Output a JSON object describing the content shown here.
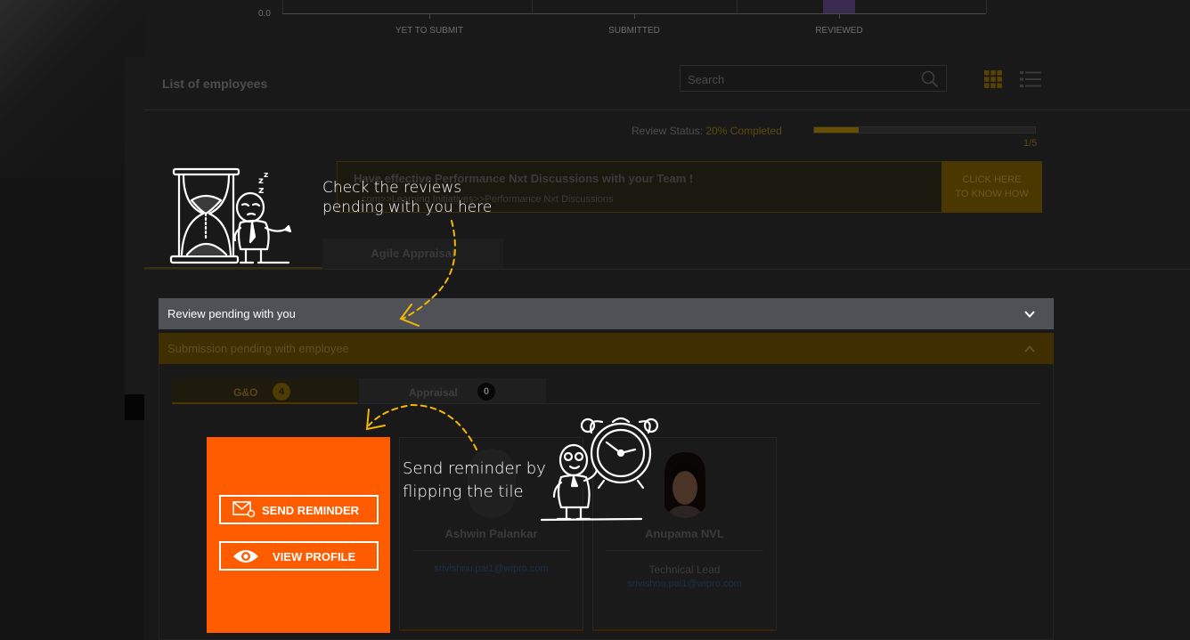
{
  "chart": {
    "y_tick": "0.0",
    "x_labels": [
      "YET TO SUBMIT",
      "SUBMITTED",
      "REVIEWED"
    ]
  },
  "list": {
    "title": "List of employees",
    "search_placeholder": "Search"
  },
  "review_status": {
    "label": "Review Status: ",
    "value": "20% Completed",
    "progress_fraction": 0.2,
    "count": "1/5"
  },
  "banner": {
    "title": "Have effective Performance Nxt Discussions with your Team !",
    "path": "...com>>Learning Initiatives>>Performance Nxt Discussions",
    "cta_line1": "CLICK HERE",
    "cta_line2": "TO KNOW HOW"
  },
  "tabs": {
    "agile": "Agile Appraisal"
  },
  "accordion": {
    "review_pending": "Review pending with you",
    "submission_pending": "Submission pending with employee"
  },
  "sub_tabs": [
    {
      "label": "G&O",
      "count": "4"
    },
    {
      "label": "Appraisal",
      "count": "0"
    }
  ],
  "flip_tile": {
    "send_reminder": "SEND REMINDER",
    "view_profile": "VIEW PROFILE"
  },
  "cards": [
    {
      "name": "Ashwin Palankar",
      "role": "",
      "email": "srivishnu.pai1@wipro.com"
    },
    {
      "name": "Anupama NVL",
      "role": "Technical Lead",
      "email": "srivishnu.pai1@wipro.com"
    }
  ],
  "coach": {
    "tip1_line1": "Check the reviews",
    "tip1_line2": "pending with you here",
    "tip2_line1": "Send reminder by",
    "tip2_line2": "flipping the tile"
  },
  "colors": {
    "accent_orange": "#ff5c00",
    "accordion_active": "#4f5157"
  }
}
